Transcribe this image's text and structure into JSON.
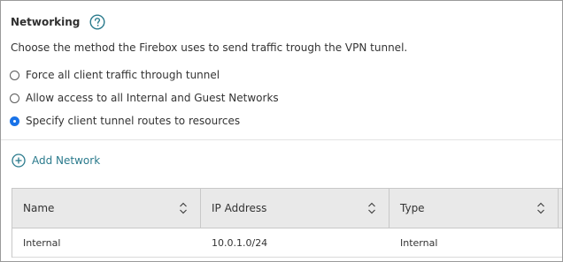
{
  "section": {
    "title": "Networking",
    "help_icon": "question-circle-icon",
    "description": "Choose the method the Firebox uses to send traffic trough the VPN tunnel."
  },
  "radio_options": [
    {
      "label": "Force all client traffic through tunnel",
      "checked": false
    },
    {
      "label": "Allow access to all Internal and Guest Networks",
      "checked": false
    },
    {
      "label": "Specify client tunnel routes to resources",
      "checked": true
    }
  ],
  "add_network": {
    "label": "Add Network",
    "icon": "plus-circle-icon"
  },
  "table": {
    "columns": [
      {
        "label": "Name",
        "sort_icon": "sort-updown-icon"
      },
      {
        "label": "IP Address",
        "sort_icon": "sort-updown-icon"
      },
      {
        "label": "Type",
        "sort_icon": "sort-updown-icon"
      }
    ],
    "rows": [
      {
        "name": "Internal",
        "ip_address": "10.0.1.0/24",
        "type": "Internal"
      }
    ]
  },
  "colors": {
    "accent_link": "#2a7a8c",
    "radio_selected": "#1a73e8",
    "header_bg": "#e9e9e9"
  }
}
